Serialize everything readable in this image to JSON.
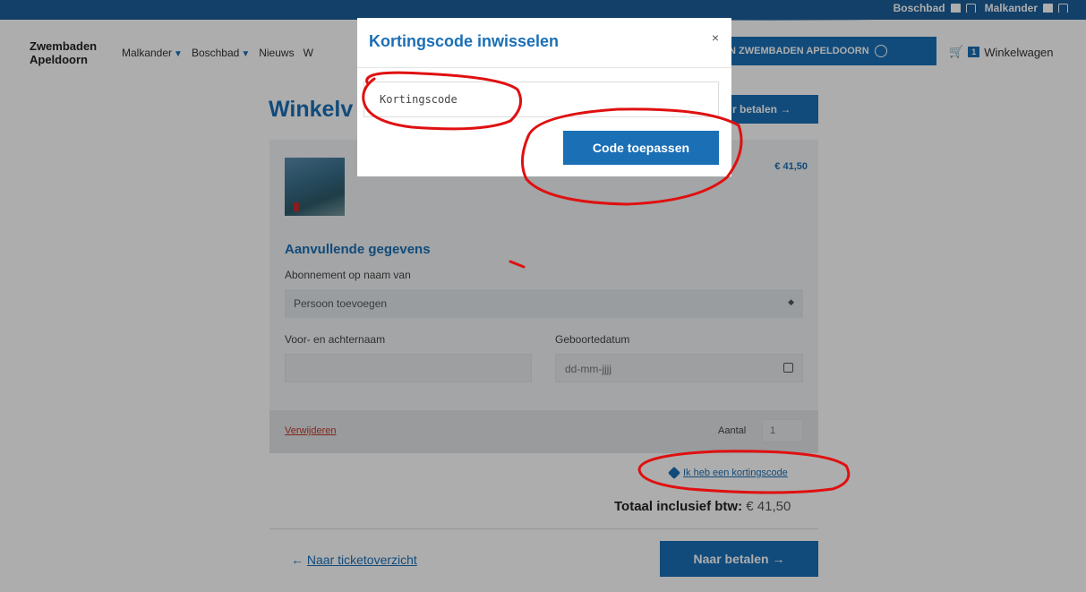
{
  "topbar": {
    "links": [
      "Boschbad",
      "Malkander"
    ]
  },
  "nav": {
    "logo_line1": "Zwembaden",
    "logo_line2": "Apeldoorn",
    "menu": [
      "Malkander",
      "Boschbad",
      "Nieuws",
      "W"
    ],
    "login_label": "N ZWEMBADEN APELDOORN",
    "cart_count": "1",
    "cart_label": "Winkelwagen"
  },
  "page": {
    "title": "Winkelv",
    "pay_top_label": "r betalen →",
    "price": "€ 41,50",
    "section_title": "Aanvullende gegevens",
    "subscription_label": "Abonnement op naam van",
    "person_select": "Persoon toevoegen",
    "name_label": "Voor- en achternaam",
    "dob_label": "Geboortedatum",
    "dob_placeholder": "dd-mm-jjjj",
    "remove_label": "Verwijderen",
    "qty_label": "Aantal",
    "qty_value": "1",
    "coupon_link": "Ik heb een kortingscode",
    "total_label": "Totaal inclusief btw:",
    "total_amount": "€ 41,50",
    "back_label": "Naar ticketoverzicht",
    "pay_bottom_label": "Naar betalen →"
  },
  "modal": {
    "title": "Kortingscode inwisselen",
    "close": "×",
    "code_placeholder": "Kortingscode",
    "apply_label": "Code toepassen"
  },
  "colors": {
    "brand_blue": "#1a6fb5",
    "annotation_red": "#e01010"
  }
}
